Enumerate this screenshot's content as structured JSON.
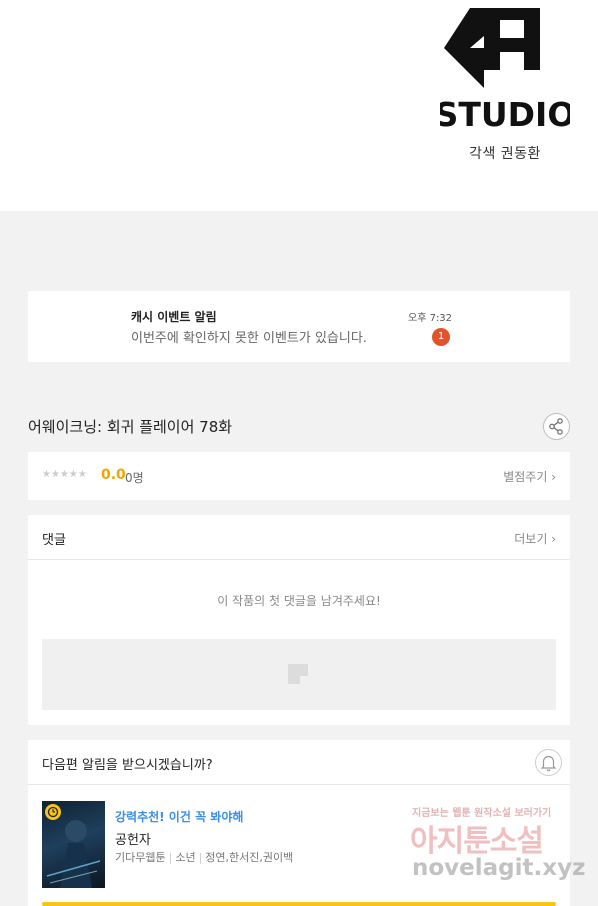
{
  "banner": {
    "logo_text": "STUDIO",
    "credit": "각색 권동환"
  },
  "notice": {
    "title": "캐시 이벤트 알림",
    "body": "이번주에 확인하지 못한 이벤트가 있습니다.",
    "time": "오후 7:32",
    "badge": "1"
  },
  "episode": {
    "title": "어웨이크닝: 회귀 플레이어 78화",
    "share_icon": "share-icon"
  },
  "rating": {
    "stars": "★★★★★",
    "score": "0.0",
    "count": "0명",
    "rate_link": "별점주기 ›"
  },
  "comments": {
    "title": "댓글",
    "more": "더보기 ›",
    "empty_text": "이 작품의 첫 댓글을 남겨주세요!"
  },
  "next_alert": {
    "title": "다음편 알림을 받으시겠습니까?",
    "bell_icon": "bell-icon"
  },
  "recommendation": {
    "tag": "강력추천! 이건 꼭 봐야해",
    "name": "공헌자",
    "genre": "기다무웹툰",
    "category": "소년",
    "authors": "정연,한서진,권이백"
  },
  "watermark": {
    "line1": "지금보는 웹툰 원작소설 보러가기",
    "line2": "아지툰소설",
    "line3": "novelagit.xyz"
  },
  "colors": {
    "accent_yellow": "#f5c518",
    "badge_red": "#e2532c",
    "link_blue": "#3a8ee6",
    "score_orange": "#f0a500"
  }
}
